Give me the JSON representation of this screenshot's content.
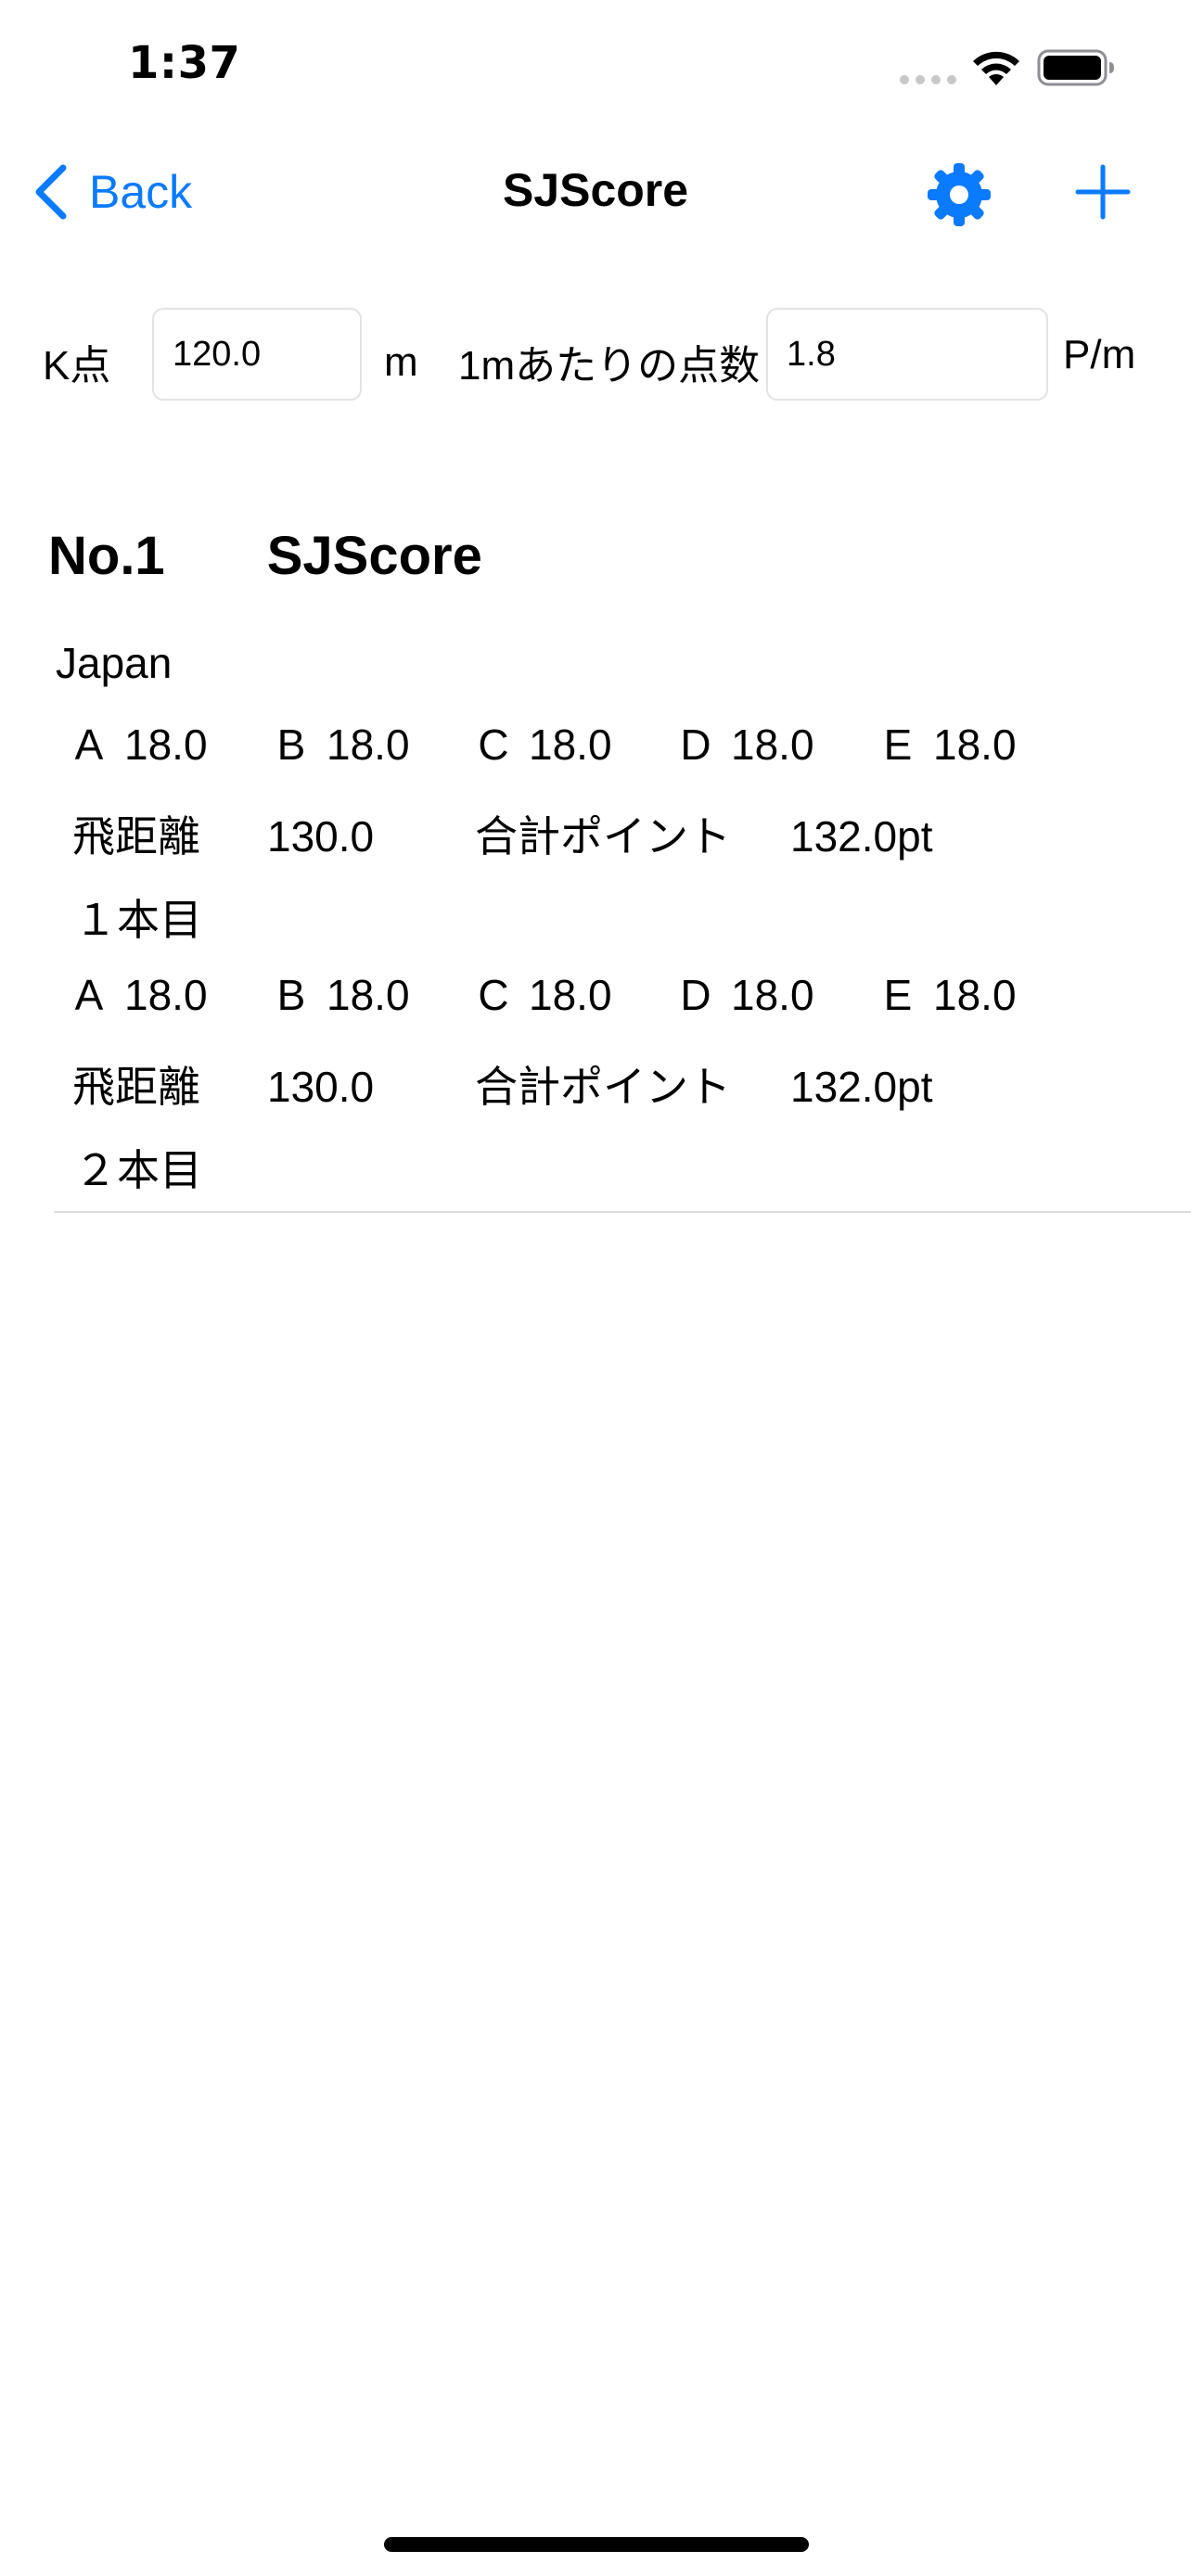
{
  "status_bar": {
    "time": "1:37"
  },
  "nav": {
    "back_label": "Back",
    "title": "SJScore",
    "accent_color": "#0a7aff",
    "icons": [
      "chevron-left-icon",
      "gear-icon",
      "plus-icon"
    ]
  },
  "params": {
    "k_point_label": "K点",
    "k_point_value": "120.0",
    "k_point_unit": "m",
    "per_meter_label": "1mあたりの点数",
    "per_meter_value": "1.8",
    "per_meter_unit": "P/m"
  },
  "section": {
    "number": "No.1",
    "name": "SJScore"
  },
  "entry": {
    "country": "Japan",
    "jump1": {
      "scores": [
        {
          "key": "A",
          "value": "18.0"
        },
        {
          "key": "B",
          "value": "18.0"
        },
        {
          "key": "C",
          "value": "18.0"
        },
        {
          "key": "D",
          "value": "18.0"
        },
        {
          "key": "E",
          "value": "18.0"
        }
      ],
      "distance_label": "飛距離",
      "distance": "130.0",
      "total_label": "合計ポイント",
      "total": "132.0pt",
      "caption": "１本目"
    },
    "jump2": {
      "scores": [
        {
          "key": "A",
          "value": "18.0"
        },
        {
          "key": "B",
          "value": "18.0"
        },
        {
          "key": "C",
          "value": "18.0"
        },
        {
          "key": "D",
          "value": "18.0"
        },
        {
          "key": "E",
          "value": "18.0"
        }
      ],
      "distance_label": "飛距離",
      "distance": "130.0",
      "total_label": "合計ポイント",
      "total": "132.0pt",
      "caption": "２本目"
    }
  }
}
